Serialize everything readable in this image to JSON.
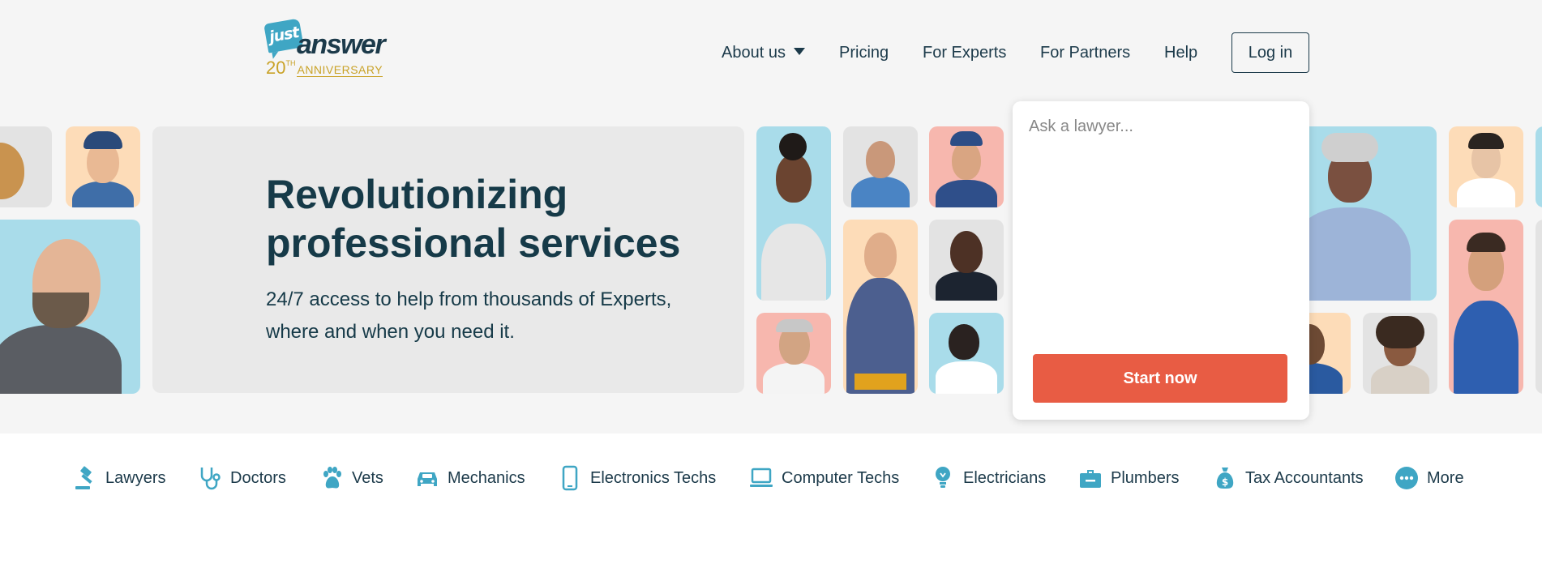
{
  "header": {
    "logo": {
      "top": "just",
      "main": "answer",
      "years": "20",
      "years_suffix": "TH",
      "anniversary": "ANNIVERSARY"
    },
    "nav": [
      {
        "label": "About us",
        "has_dropdown": true
      },
      {
        "label": "Pricing"
      },
      {
        "label": "For Experts"
      },
      {
        "label": "For Partners"
      },
      {
        "label": "Help"
      }
    ],
    "login_label": "Log in"
  },
  "hero": {
    "title": "Revolutionizing professional services",
    "subtitle": "24/7 access to help from thousands of Experts, where and when you need it."
  },
  "ask": {
    "placeholder": "Ask a lawyer...",
    "button_label": "Start now"
  },
  "categories": [
    {
      "label": "Lawyers",
      "icon": "gavel-icon"
    },
    {
      "label": "Doctors",
      "icon": "stethoscope-icon"
    },
    {
      "label": "Vets",
      "icon": "paw-icon"
    },
    {
      "label": "Mechanics",
      "icon": "car-icon"
    },
    {
      "label": "Electronics Techs",
      "icon": "phone-icon"
    },
    {
      "label": "Computer Techs",
      "icon": "laptop-icon"
    },
    {
      "label": "Electricians",
      "icon": "lightbulb-icon"
    },
    {
      "label": "Plumbers",
      "icon": "toolbox-icon"
    },
    {
      "label": "Tax Accountants",
      "icon": "money-bag-icon"
    },
    {
      "label": "More",
      "icon": "more-icon"
    }
  ],
  "colors": {
    "brand_dark": "#1c3a4a",
    "accent": "#e85c44",
    "icon_blue": "#3fa6c4",
    "gold": "#c9a227"
  }
}
